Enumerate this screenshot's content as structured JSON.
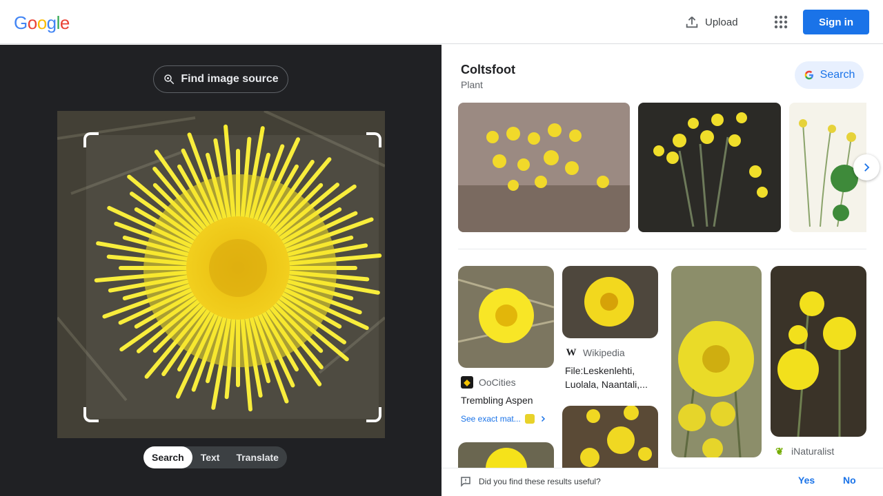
{
  "header": {
    "logo_letters": [
      "G",
      "o",
      "o",
      "g",
      "l",
      "e"
    ],
    "logo_colors": [
      "#4285f4",
      "#ea4335",
      "#fbbc05",
      "#4285f4",
      "#34a853",
      "#ea4335"
    ],
    "upload_label": "Upload",
    "apps_icon": "grid-icon",
    "signin_label": "Sign in"
  },
  "left": {
    "find_source_label": "Find image source",
    "modes": [
      {
        "label": "Search",
        "active": true
      },
      {
        "label": "Text",
        "active": false
      },
      {
        "label": "Translate",
        "active": false
      }
    ]
  },
  "knowledge": {
    "title": "Coltsfoot",
    "subtitle": "Plant",
    "search_label": "Search"
  },
  "results": {
    "col1": {
      "source": "OoCities",
      "title": "Trembling Aspen",
      "exact_match": "See exact mat..."
    },
    "col2": {
      "source": "Wikipedia",
      "title_line1": "File:Leskenlehti,",
      "title_line2": "Luolala, Naantali,..."
    },
    "col4": {
      "source": "iNaturalist"
    }
  },
  "feedback": {
    "question": "Did you find these results useful?",
    "yes": "Yes",
    "no": "No"
  },
  "colors": {
    "accent": "#1a73e8",
    "dark_panel": "#202124",
    "flower_yellow": "#f5e21a"
  }
}
